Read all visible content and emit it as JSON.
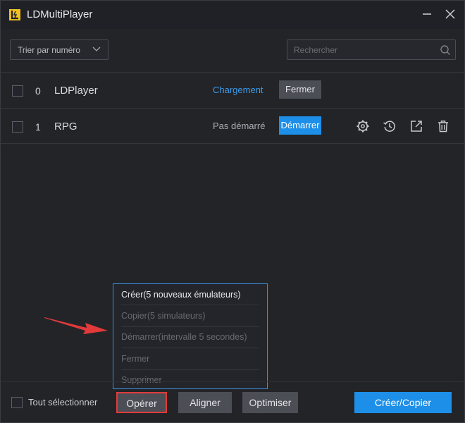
{
  "window": {
    "title": "LDMultiPlayer",
    "accent": "#1d8fe8"
  },
  "toolbar": {
    "sort_label": "Trier par numéro",
    "search_placeholder": "Rechercher"
  },
  "players": [
    {
      "index": "0",
      "name": "LDPlayer",
      "status": "Chargement",
      "status_color": "#3d9be9",
      "action": "Fermer"
    },
    {
      "index": "1",
      "name": "RPG",
      "status": "Pas démarré",
      "status_color": "#a9acb2",
      "action": "Démarrer",
      "icons": [
        "gear-icon",
        "history-icon",
        "shortcut-icon",
        "trash-icon"
      ]
    }
  ],
  "operate_menu": {
    "items": [
      {
        "label": "Créer(5 nouveaux émulateurs)",
        "enabled": true
      },
      {
        "label": "Copier(5 simulateurs)",
        "enabled": false
      },
      {
        "label": "Démarrer(intervalle 5 secondes)",
        "enabled": false
      },
      {
        "label": "Fermer",
        "enabled": false
      },
      {
        "label": "Supprimer",
        "enabled": false
      }
    ]
  },
  "bottom": {
    "select_all_label": "Tout sélectionner",
    "operate_label": "Opérer",
    "align_label": "Aligner",
    "optimize_label": "Optimiser",
    "create_copy_label": "Créer/Copier"
  }
}
